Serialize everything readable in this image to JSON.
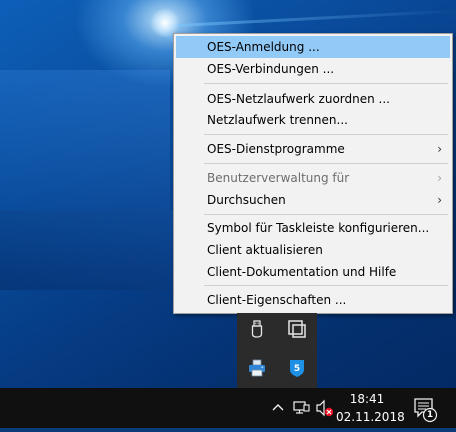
{
  "menu": {
    "items": [
      {
        "label": "OES-Anmeldung ..."
      },
      {
        "label": "OES-Verbindungen ..."
      },
      {
        "label": "OES-Netzlaufwerk zuordnen ..."
      },
      {
        "label": "Netzlaufwerk trennen..."
      },
      {
        "label": "OES-Dienstprogramme",
        "submenu": true
      },
      {
        "label": "Benutzerverwaltung für",
        "submenu": true,
        "disabled": true
      },
      {
        "label": "Durchsuchen",
        "submenu": true
      },
      {
        "label": "Symbol für Taskleiste konfigurieren..."
      },
      {
        "label": "Client aktualisieren"
      },
      {
        "label": "Client-Dokumentation und Hilfe"
      },
      {
        "label": "Client-Eigenschaften ..."
      }
    ],
    "highlighted_index": 0,
    "submenu_arrow": "›"
  },
  "tray_popup": {
    "icons": [
      "usb-device-icon",
      "screen-capture-icon",
      "network-printer-icon",
      "oes-client-icon"
    ]
  },
  "taskbar": {
    "time": "18:41",
    "date": "02.11.2018",
    "notification_count": "1",
    "icons": [
      "chevron-up-icon",
      "network-icon",
      "volume-muted-icon",
      "action-center-icon"
    ]
  },
  "colors": {
    "menu_background": "#f2f2f2",
    "menu_highlight": "#91c9f7",
    "taskbar": "#101010",
    "tray_popup": "#2b2b2b",
    "accent_blue": "#1e90e6",
    "muted_red": "#e81123"
  }
}
